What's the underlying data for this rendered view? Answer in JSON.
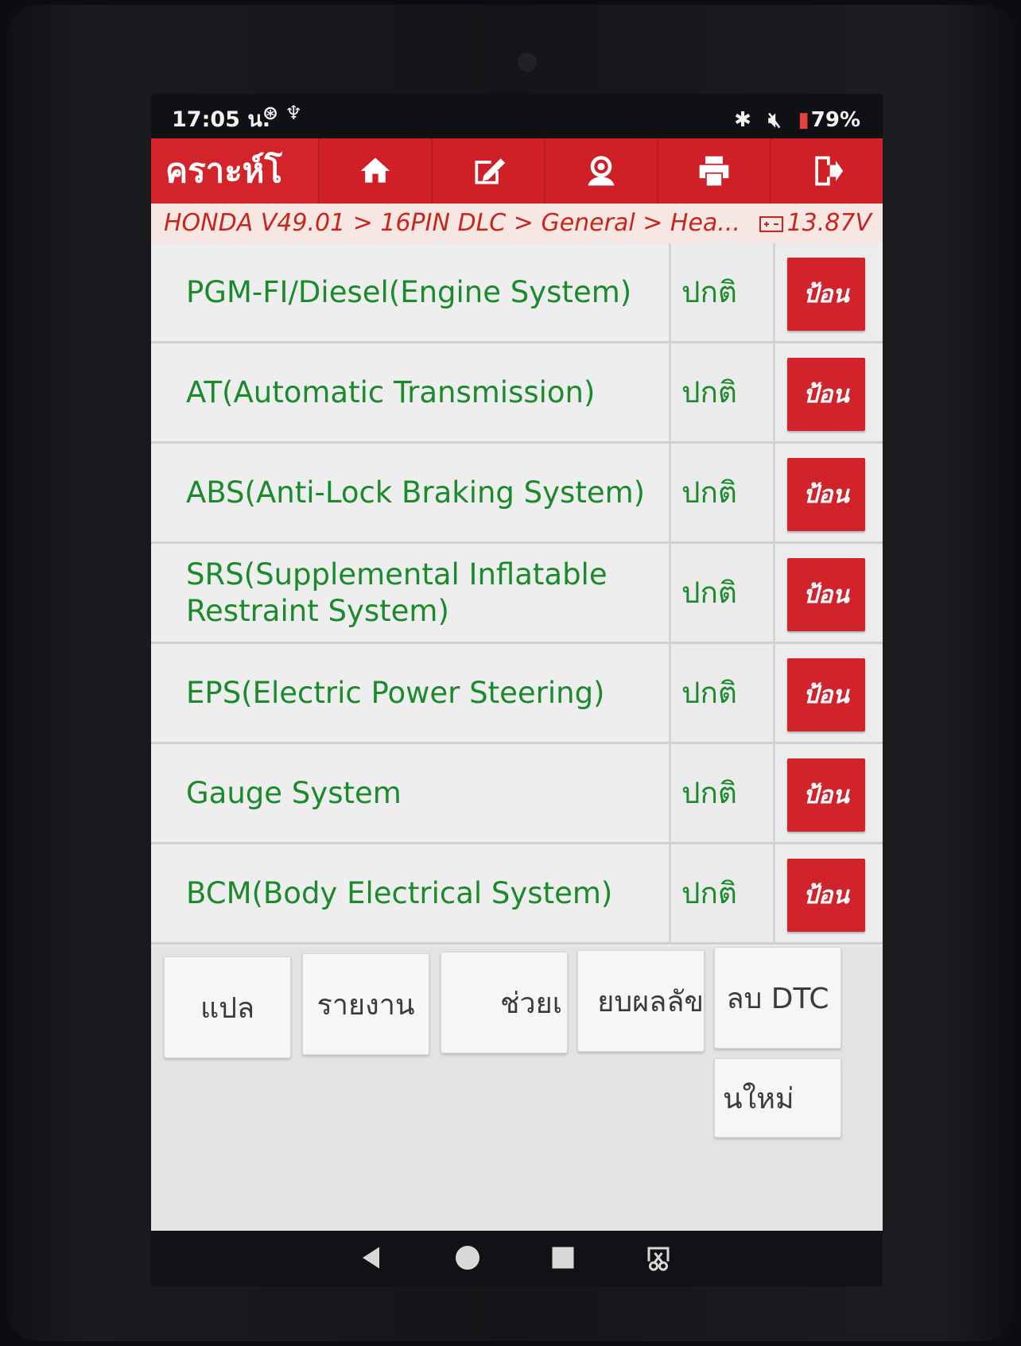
{
  "status_bar": {
    "time": "17:05 น.",
    "left_icons": "⊛ ♆",
    "bluetooth": "✱",
    "mute": "🔕",
    "battery": "79%"
  },
  "toolbar": {
    "title": "คราะห์โ",
    "buttons": [
      "home-icon",
      "edit-icon",
      "support-icon",
      "print-icon",
      "exit-icon"
    ]
  },
  "breadcrumb": {
    "path": "HONDA V49.01 > 16PIN DLC > General > Hea...",
    "voltage": "13.87V"
  },
  "systems": [
    {
      "name": "PGM-FI/Diesel(Engine System)",
      "status": "ปกติ",
      "action": "ป้อน"
    },
    {
      "name": "AT(Automatic Transmission)",
      "status": "ปกติ",
      "action": "ป้อน"
    },
    {
      "name": "ABS(Anti-Lock Braking System)",
      "status": "ปกติ",
      "action": "ป้อน"
    },
    {
      "name": "SRS(Supplemental Inflatable Restraint System)",
      "status": "ปกติ",
      "action": "ป้อน"
    },
    {
      "name": "EPS(Electric Power Steering)",
      "status": "ปกติ",
      "action": "ป้อน"
    },
    {
      "name": "Gauge System",
      "status": "ปกติ",
      "action": "ป้อน"
    },
    {
      "name": "BCM(Body Electrical System)",
      "status": "ปกติ",
      "action": "ป้อน"
    }
  ],
  "footer_buttons": {
    "translate": "แปล",
    "report": "รายงาน",
    "help": "ช่วยเ",
    "delete_results": "ยบผลลัข",
    "clear_dtc": "ลบ DTC",
    "new": "นใหม่"
  },
  "colors": {
    "brand": "#cf2027",
    "text_ok": "#1b8a2c"
  }
}
